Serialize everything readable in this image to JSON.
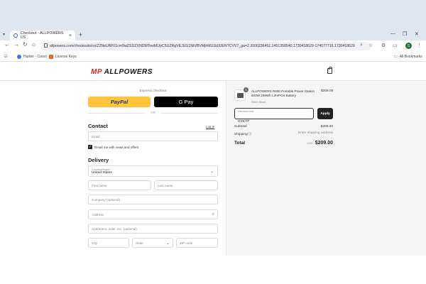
{
  "browser": {
    "tab_title": "Checkout - ALLPOWERS US",
    "new_tab": "+",
    "url": "allpowers.com/checkouts/cn/Z2NeUlWV1cm9wZS1lZXNDMTowMUpC5UZRgVEJUG1NtVBVMjhMU1k0UENTCVV7_ga=2.2000236451.1451358540.1730418629-174077716.1730418629",
    "bookmarks": [
      {
        "label": "Hunter - Curso",
        "color": "#3a78d8"
      },
      {
        "label": "License Keys",
        "color": "#e46b2b"
      }
    ],
    "all_bookmarks": "All Bookmarks",
    "avatar_letter": "S"
  },
  "header": {
    "logo_mark": "MP",
    "logo_text": "ALLPOWERS"
  },
  "checkout": {
    "express_label": "Express checkout",
    "paypal_label": "PayPal",
    "gpay_label": "G Pay",
    "or_label": "OR",
    "contact_title": "Contact",
    "login_label": "Log in",
    "email_placeholder": "Email",
    "newsletter_label": "Email me with news and offers",
    "delivery_title": "Delivery",
    "country_label": "Country/Region",
    "country_value": "United States",
    "first_name_placeholder": "First name",
    "last_name_placeholder": "Last name",
    "company_placeholder": "Company (optional)",
    "address_placeholder": "Address",
    "apartment_placeholder": "Apartment, suite, etc. (optional)",
    "city_placeholder": "City",
    "state_placeholder": "State",
    "zip_placeholder": "ZIP code"
  },
  "summary": {
    "qty": "1",
    "product_name": "ALLPOWERS R600 Portable Power Station 600W 299Wh LiFePO4 Battery",
    "variant": "R600 Black",
    "price": "$209.00",
    "discount_label": "Discount code",
    "discount_value": "GYKYF",
    "apply_label": "Apply",
    "subtotal_label": "Subtotal",
    "subtotal_value": "$209.00",
    "shipping_label": "Shipping ⓘ",
    "shipping_value": "Enter shipping address",
    "total_label": "Total",
    "currency": "USD",
    "total_value": "$209.00"
  }
}
